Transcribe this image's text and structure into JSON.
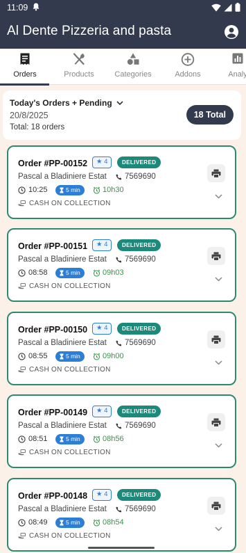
{
  "status_bar": {
    "time": "11:09"
  },
  "app_bar": {
    "title": "Al Dente Pizzeria and pasta"
  },
  "tabs": [
    {
      "label": "Orders",
      "icon": "receipt-icon",
      "active": true
    },
    {
      "label": "Products",
      "icon": "utensils-icon",
      "active": false
    },
    {
      "label": "Categories",
      "icon": "shapes-icon",
      "active": false
    },
    {
      "label": "Addons",
      "icon": "add-circle-icon",
      "active": false
    },
    {
      "label": "Analy",
      "icon": "analytics-icon",
      "active": false
    }
  ],
  "summary": {
    "heading": "Today's Orders + Pending",
    "date": "20/8/2025",
    "total_line": "Total: 18 orders",
    "badge": "18 Total"
  },
  "orders": [
    {
      "number": "Order #PP-00152",
      "rating": "4",
      "status": "DELIVERED",
      "customer": "Pascal a Bladiniere Estat",
      "phone": "7569690",
      "time": "10:25",
      "prep": "5 min",
      "ready": "10h30",
      "payment": "CASH ON COLLECTION"
    },
    {
      "number": "Order #PP-00151",
      "rating": "4",
      "status": "DELIVERED",
      "customer": "Pascal a Bladiniere Estat",
      "phone": "7569690",
      "time": "08:58",
      "prep": "5 min",
      "ready": "09h03",
      "payment": "CASH ON COLLECTION"
    },
    {
      "number": "Order #PP-00150",
      "rating": "4",
      "status": "DELIVERED",
      "customer": "Pascal a Bladiniere Estat",
      "phone": "7569690",
      "time": "08:55",
      "prep": "5 min",
      "ready": "09h00",
      "payment": "CASH ON COLLECTION"
    },
    {
      "number": "Order #PP-00149",
      "rating": "4",
      "status": "DELIVERED",
      "customer": "Pascal a Bladiniere Estat",
      "phone": "7569690",
      "time": "08:51",
      "prep": "5 min",
      "ready": "08h56",
      "payment": "CASH ON COLLECTION"
    },
    {
      "number": "Order #PP-00148",
      "rating": "4",
      "status": "DELIVERED",
      "customer": "Pascal a Bladiniere Estat",
      "phone": "7569690",
      "time": "08:49",
      "prep": "5 min",
      "ready": "08h54",
      "payment": "CASH ON COLLECTION"
    }
  ],
  "colors": {
    "app_bar": "#343a4d",
    "background": "#fbf1e9",
    "card_border": "#2d8a6c",
    "delivered_badge": "#1c8a7a",
    "prep_badge": "#2d7fd6",
    "ready_time": "#2e9a40"
  }
}
